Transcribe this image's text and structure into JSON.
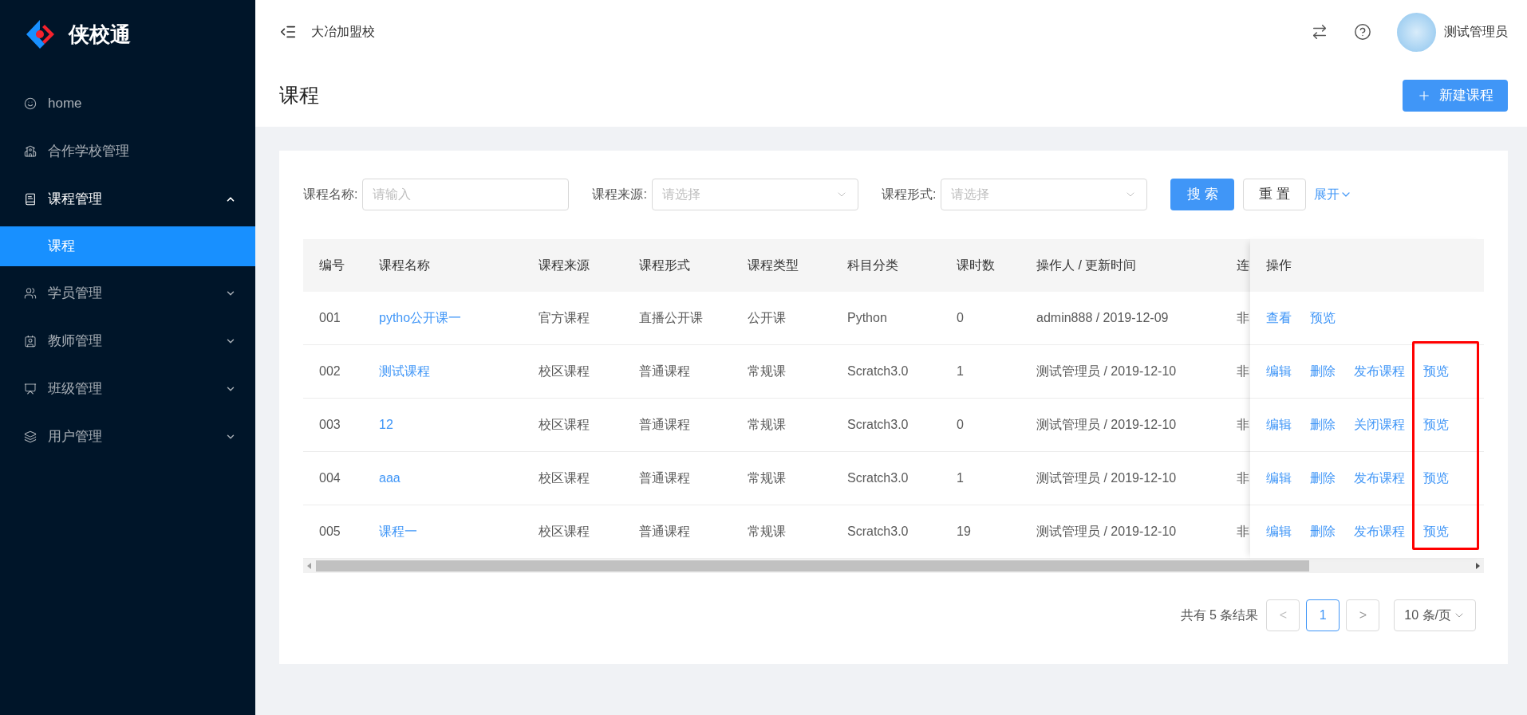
{
  "sidebar": {
    "logo_text": "侠校通",
    "items": [
      {
        "kind": "smile",
        "label": "home"
      },
      {
        "kind": "school",
        "label": "合作学校管理"
      },
      {
        "kind": "book",
        "label": "课程管理",
        "expanded": true,
        "children": [
          {
            "label": "课程",
            "selected": true
          }
        ]
      },
      {
        "kind": "users",
        "label": "学员管理",
        "expanded": false
      },
      {
        "kind": "contact",
        "label": "教师管理",
        "expanded": false
      },
      {
        "kind": "board",
        "label": "班级管理",
        "expanded": false
      },
      {
        "kind": "layers",
        "label": "用户管理",
        "expanded": false
      }
    ]
  },
  "header": {
    "school": "大冶加盟校",
    "user": "测试管理员"
  },
  "page": {
    "title": "课程",
    "new_button": "新建课程"
  },
  "filters": {
    "fields": [
      {
        "kind": "input",
        "label": "课程名称:",
        "placeholder": "请输入"
      },
      {
        "kind": "select",
        "label": "课程来源:",
        "placeholder": "请选择"
      },
      {
        "kind": "select",
        "label": "课程形式:",
        "placeholder": "请选择"
      }
    ],
    "search": "搜 索",
    "reset": "重 置",
    "expand": "展开"
  },
  "table": {
    "columns": [
      "编号",
      "课程名称",
      "课程来源",
      "课程形式",
      "课程类型",
      "科目分类",
      "课时数",
      "操作人 / 更新时间",
      "连"
    ],
    "actions_column": "操作",
    "rows": [
      {
        "cells": [
          "001",
          "pytho公开课一",
          "官方课程",
          "直播公开课",
          "公开课",
          "Python",
          "0",
          "admin888 / 2019-12-09",
          "非"
        ],
        "actions": [
          "查看",
          "预览"
        ]
      },
      {
        "cells": [
          "002",
          "测试课程",
          "校区课程",
          "普通课程",
          "常规课",
          "Scratch3.0",
          "1",
          "测试管理员 / 2019-12-10",
          "非"
        ],
        "actions": [
          "编辑",
          "删除",
          "发布课程",
          "预览"
        ]
      },
      {
        "cells": [
          "003",
          "12",
          "校区课程",
          "普通课程",
          "常规课",
          "Scratch3.0",
          "0",
          "测试管理员 / 2019-12-10",
          "非"
        ],
        "actions": [
          "编辑",
          "删除",
          "关闭课程",
          "预览"
        ]
      },
      {
        "cells": [
          "004",
          "aaa",
          "校区课程",
          "普通课程",
          "常规课",
          "Scratch3.0",
          "1",
          "测试管理员 / 2019-12-10",
          "非"
        ],
        "actions": [
          "编辑",
          "删除",
          "发布课程",
          "预览"
        ]
      },
      {
        "cells": [
          "005",
          "课程一",
          "校区课程",
          "普通课程",
          "常规课",
          "Scratch3.0",
          "19",
          "测试管理员 / 2019-12-10",
          "非"
        ],
        "actions": [
          "编辑",
          "删除",
          "发布课程",
          "预览"
        ]
      }
    ],
    "highlight_frame": true
  },
  "pagination": {
    "total": "共有 5 条结果",
    "prev": "<",
    "pages": [
      {
        "label": "1",
        "selected": true
      }
    ],
    "next": ">",
    "page_size": "10 条/页"
  }
}
